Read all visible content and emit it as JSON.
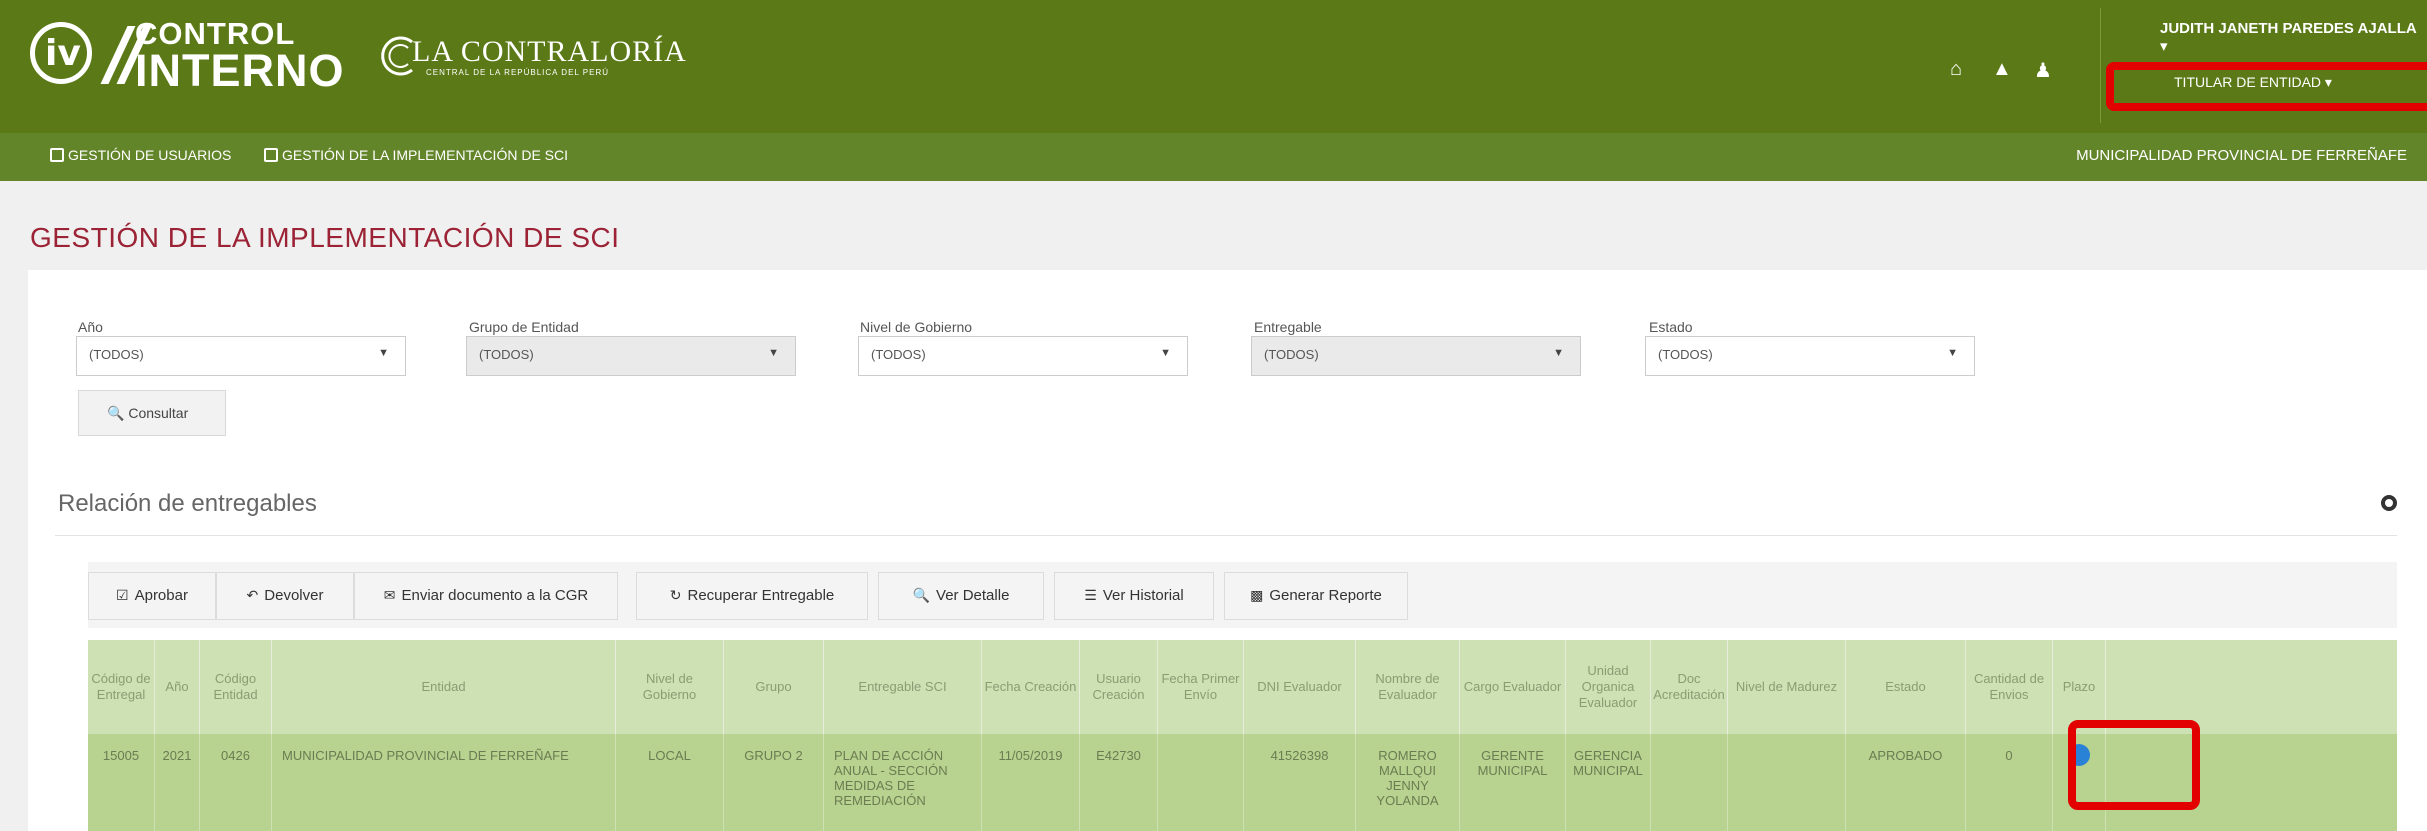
{
  "header": {
    "brand_line1": "CONTROL",
    "brand_line2": "INTERNO",
    "contraloria_title": "LA CONTRALORÍA",
    "contraloria_subtitle": "CENTRAL DE LA REPÚBLICA DEL PERÚ",
    "user_name": "JUDITH JANETH PAREDES AJALLA",
    "user_role": "TITULAR DE ENTIDAD",
    "highlight_color": "#e30000"
  },
  "nav": {
    "items": [
      {
        "label": "GESTIÓN DE USUARIOS"
      },
      {
        "label": "GESTIÓN DE LA IMPLEMENTACIÓN DE SCI"
      }
    ],
    "entity": "MUNICIPALIDAD PROVINCIAL DE FERREÑAFE"
  },
  "page": {
    "title": "GESTIÓN DE LA IMPLEMENTACIÓN DE SCI"
  },
  "filters": [
    {
      "label": "Año",
      "value": "(TODOS)",
      "disabled": false
    },
    {
      "label": "Grupo de Entidad",
      "value": "(TODOS)",
      "disabled": true
    },
    {
      "label": "Nivel de Gobierno",
      "value": "(TODOS)",
      "disabled": false
    },
    {
      "label": "Entregable",
      "value": "(TODOS)",
      "disabled": true
    },
    {
      "label": "Estado",
      "value": "(TODOS)",
      "disabled": false
    }
  ],
  "consultar_label": "Consultar",
  "section": {
    "title": "Relación de entregables"
  },
  "toolbar": [
    {
      "icon": "check-square-icon",
      "label": "Aprobar"
    },
    {
      "icon": "undo-icon",
      "label": "Devolver"
    },
    {
      "icon": "envelope-icon",
      "label": "Enviar documento a la CGR"
    },
    {
      "icon": "refresh-icon",
      "label": "Recuperar Entregable"
    },
    {
      "icon": "search-icon",
      "label": "Ver Detalle"
    },
    {
      "icon": "list-icon",
      "label": "Ver Historial"
    },
    {
      "icon": "bar-chart-icon",
      "label": "Generar Reporte"
    }
  ],
  "table": {
    "columns": [
      "Código de Entregal",
      "Año",
      "Código Entidad",
      "Entidad",
      "Nivel de Gobierno",
      "Grupo",
      "Entregable SCI",
      "Fecha Creación",
      "Usuario Creación",
      "Fecha Primer Envío",
      "DNI Evaluador",
      "Nombre de Evaluador",
      "Cargo Evaluador",
      "Unidad Organica Evaluador",
      "Doc Acreditación",
      "Nivel de Madurez",
      "Estado",
      "Cantidad de Envios",
      "Plazo"
    ],
    "rows": [
      [
        "15005",
        "2021",
        "0426",
        "MUNICIPALIDAD PROVINCIAL DE FERREÑAFE",
        "LOCAL",
        "GRUPO 2",
        "PLAN DE ACCIÓN ANUAL - SECCIÓN MEDIDAS DE REMEDIACIÓN",
        "11/05/2019",
        "E42730",
        "",
        "41526398",
        "ROMERO MALLQUI JENNY YOLANDA",
        "GERENTE MUNICIPAL",
        "GERENCIA MUNICIPAL",
        "",
        "",
        "APROBADO",
        "0",
        ""
      ]
    ]
  }
}
